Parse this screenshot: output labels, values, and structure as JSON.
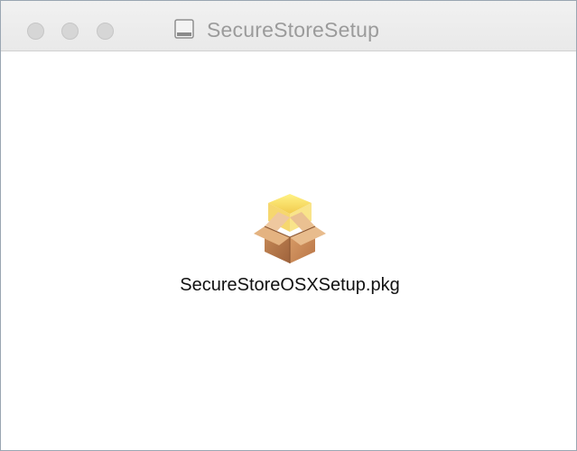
{
  "window": {
    "title": "SecureStoreSetup",
    "title_icon": "disk-image-icon",
    "controls": [
      "close",
      "minimize",
      "zoom"
    ]
  },
  "content": {
    "items": [
      {
        "name": "SecureStoreOSXSetup.pkg",
        "icon": "package-box-icon"
      }
    ]
  },
  "colors": {
    "titlebar": "#ececec",
    "title_text": "#9b9b9b",
    "traffic_light": "#d6d6d6",
    "border": "#9aa6b2"
  }
}
